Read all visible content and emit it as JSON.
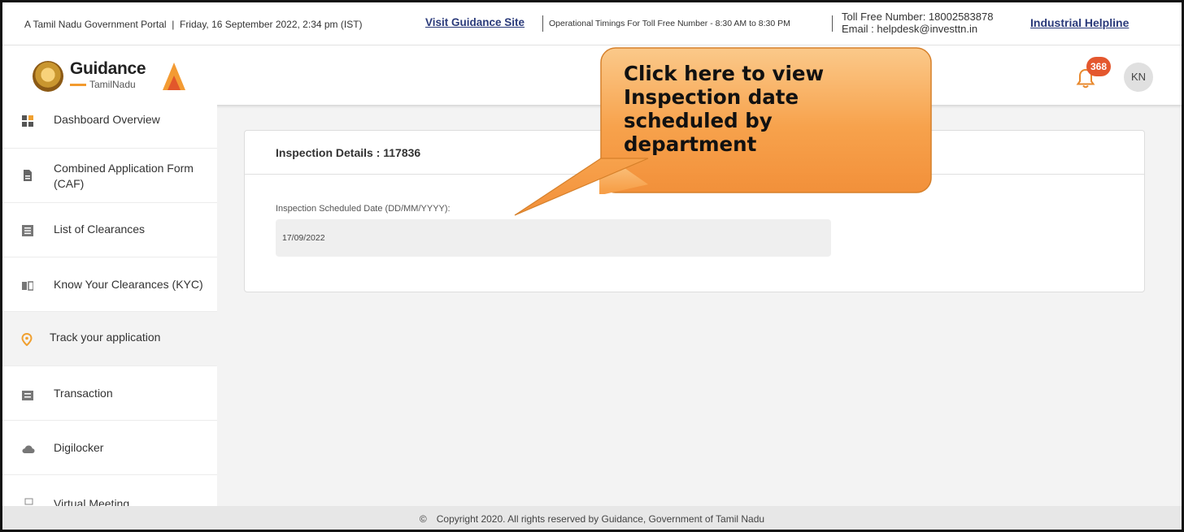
{
  "topbar": {
    "portal_text": "A Tamil Nadu Government Portal",
    "datetime": "Friday, 16 September 2022, 2:34 pm (IST)",
    "visit_link": "Visit Guidance Site",
    "timings": "Operational Timings For Toll Free Number - 8:30 AM to 8:30 PM",
    "toll_free": "Toll Free Number: 18002583878",
    "email": "Email : helpdesk@investtn.in",
    "helpline_link": "Industrial Helpline"
  },
  "header": {
    "brand": "Guidance",
    "brand_sub": "TamilNadu",
    "notification_count": "368",
    "avatar_initials": "KN"
  },
  "sidebar": {
    "items": [
      {
        "label": "Dashboard Overview",
        "icon": "dashboard-icon"
      },
      {
        "label": "Combined Application Form (CAF)",
        "icon": "document-icon"
      },
      {
        "label": "List of Clearances",
        "icon": "list-icon"
      },
      {
        "label": "Know Your Clearances (KYC)",
        "icon": "book-icon"
      },
      {
        "label": "Track your application",
        "icon": "location-pin-icon",
        "active": true
      },
      {
        "label": "Transaction",
        "icon": "transaction-icon"
      },
      {
        "label": "Digilocker",
        "icon": "cloud-icon"
      },
      {
        "label": "Virtual Meeting",
        "icon": "video-meeting-icon"
      }
    ]
  },
  "main": {
    "card_title": "Inspection Details : 117836",
    "field_label": "Inspection Scheduled Date (DD/MM/YYYY):",
    "field_value": "17/09/2022"
  },
  "callout": {
    "text": "Click here to view Inspection date scheduled by department"
  },
  "footer": {
    "symbol": "©",
    "copyright": "Copyright 2020. All rights reserved by Guidance, Government of Tamil Nadu"
  },
  "colors": {
    "accent_orange": "#f39b33",
    "badge_red": "#e4572e",
    "link_blue": "#2a3a7a",
    "active_pin": "#f0a030"
  }
}
